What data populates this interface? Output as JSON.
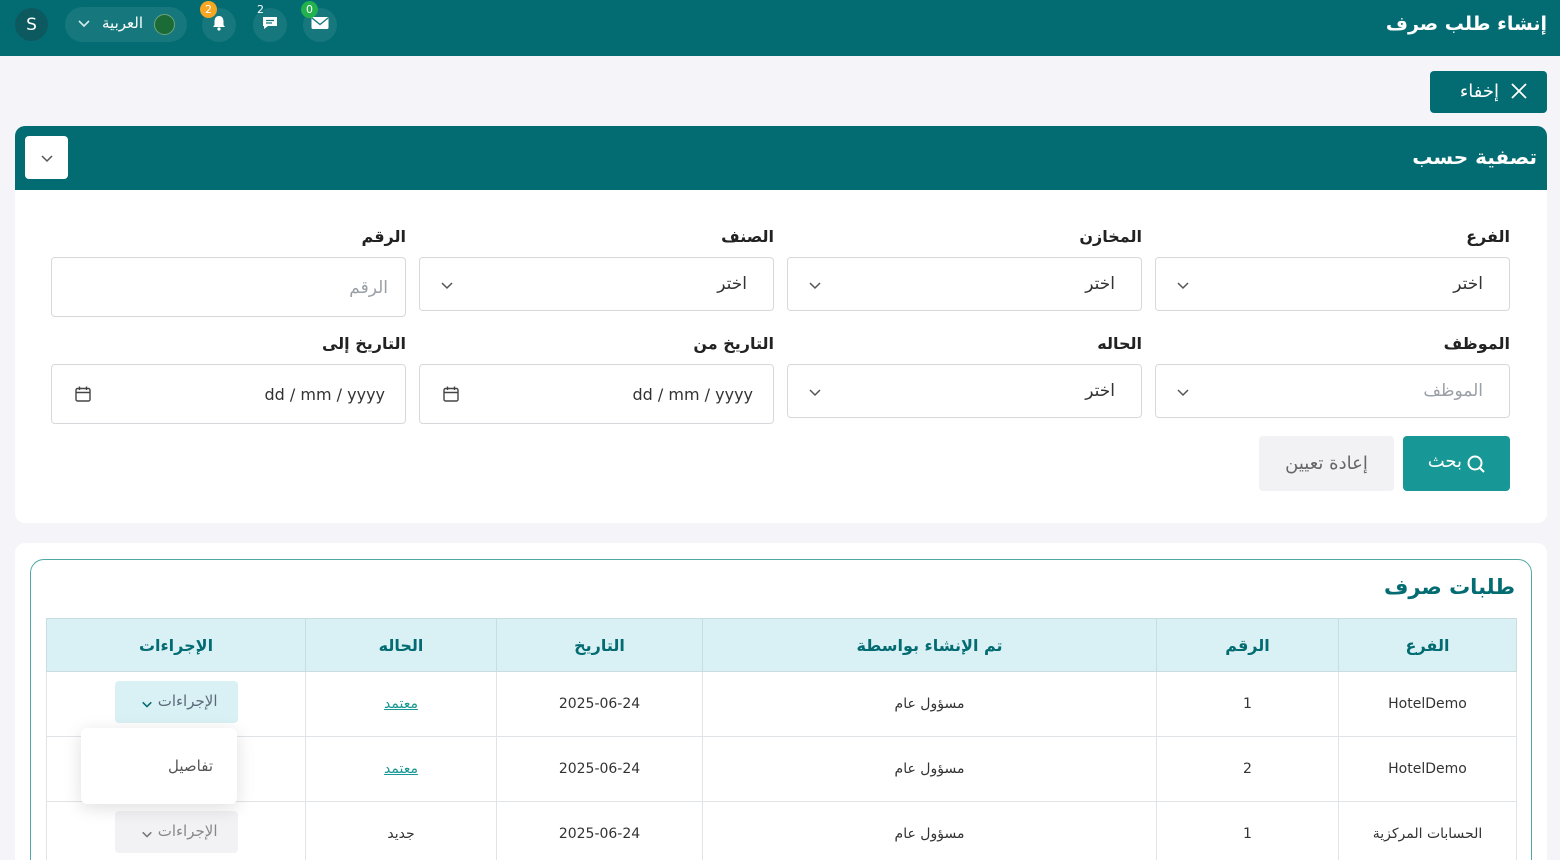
{
  "header": {
    "title": "إنشاء طلب صرف",
    "avatar_initial": "S",
    "language": "العربية",
    "notifications_count": "2",
    "messages_count": "2",
    "mail_count": "0"
  },
  "hide_button": {
    "label": "إخفاء"
  },
  "filter": {
    "title": "تصفية حسب",
    "fields": {
      "branch": {
        "label": "الفرع",
        "value": "اختر"
      },
      "stores": {
        "label": "المخازن",
        "value": "اختر"
      },
      "category": {
        "label": "الصنف",
        "value": "اختر"
      },
      "number": {
        "label": "الرقم",
        "placeholder": "الرقم"
      },
      "employee": {
        "label": "الموظف",
        "placeholder": "الموظف"
      },
      "status": {
        "label": "الحاله",
        "value": "اختر"
      },
      "date_from": {
        "label": "التاريخ من",
        "placeholder": "dd / mm / yyyy"
      },
      "date_to": {
        "label": "التاريخ إلى",
        "placeholder": "dd / mm / yyyy"
      }
    },
    "search_label": "بحث",
    "reset_label": "إعادة تعيين"
  },
  "table": {
    "title": "طلبات صرف",
    "columns": [
      "الفرع",
      "الرقم",
      "تم الإنشاء بواسطة",
      "التاريخ",
      "الحاله",
      "الإجراءات"
    ],
    "rows": [
      {
        "branch": "HotelDemo",
        "number": "1",
        "created_by": "مسؤول عام",
        "date": "2025-06-24",
        "status": "معتمد",
        "action": "الإجراءات"
      },
      {
        "branch": "HotelDemo",
        "number": "2",
        "created_by": "مسؤول عام",
        "date": "2025-06-24",
        "status": "معتمد",
        "action": ""
      },
      {
        "branch": "الحسابات المركزية",
        "number": "1",
        "created_by": "مسؤول عام",
        "date": "2025-06-24",
        "status": "جديد",
        "action": "الإجراءات"
      }
    ],
    "dropdown_item": "تفاصيل"
  },
  "colors": {
    "primary": "#036c72",
    "accent": "#179795",
    "header_row": "#d9f1f4",
    "badge_orange": "#f5a623",
    "badge_green": "#22b14c"
  }
}
